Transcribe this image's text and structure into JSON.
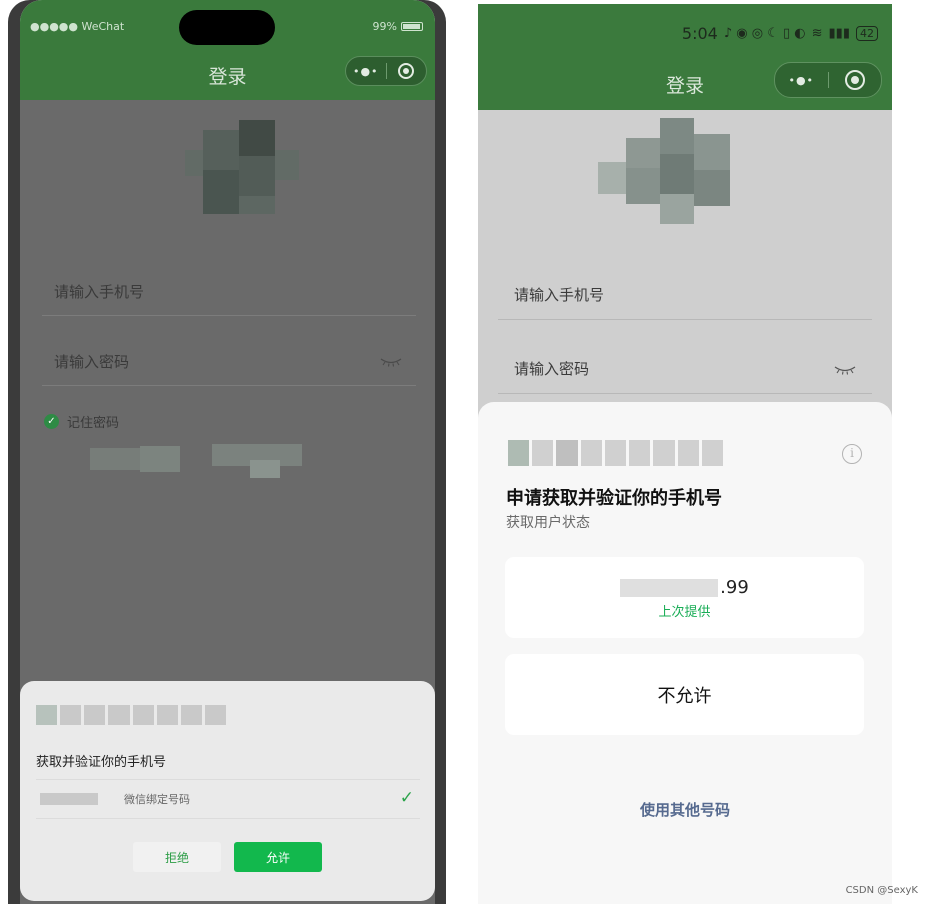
{
  "left": {
    "status_carrier": "●●●●● WeChat",
    "status_battery": "99%",
    "nav_title": "登录",
    "capsule_menu": "•●•",
    "phone_placeholder": "请输入手机号",
    "password_placeholder": "请输入密码",
    "remember_label": "记住密码",
    "sheet": {
      "title": "获取并验证你的手机号",
      "row_label": "微信绑定号码",
      "reject_label": "拒绝",
      "allow_label": "允许"
    }
  },
  "right": {
    "status_time": "5:04",
    "status_battery": "42",
    "nav_title": "登录",
    "capsule_menu": "•●•",
    "phone_placeholder": "请输入手机号",
    "password_placeholder": "请输入密码",
    "sheet": {
      "title": "申请获取并验证你的手机号",
      "subtitle": "获取用户状态",
      "phone_tail": ".99",
      "last_provided": "上次提供",
      "deny_label": "不允许",
      "other_number": "使用其他号码"
    }
  },
  "watermark": "CSDN @SexyK",
  "colors": {
    "nav_green": "#3a7a3c",
    "allow_green": "#12b84d",
    "link_blue": "#566a8f"
  },
  "icons": [
    "wifi-icon",
    "battery-icon",
    "capsule-menu-icon",
    "capsule-close-icon",
    "eye-closed-icon",
    "check-circle-icon",
    "checkmark-icon",
    "info-icon"
  ]
}
